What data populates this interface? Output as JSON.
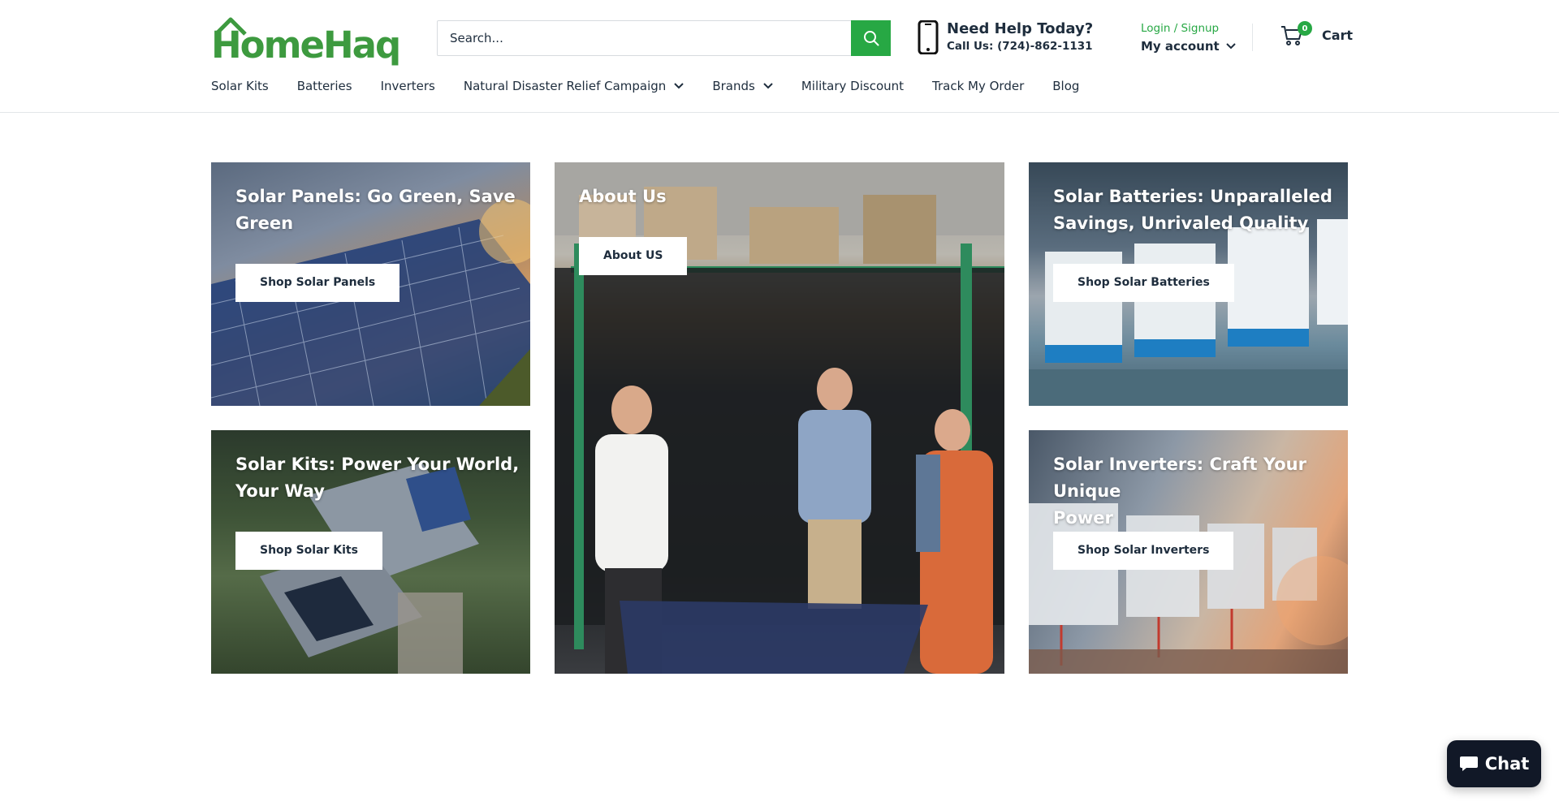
{
  "header": {
    "logo_text": "HomeHaq",
    "search": {
      "placeholder": "Search..."
    },
    "help": {
      "title": "Need Help Today?",
      "phone": "Call Us: (724)-862-1131"
    },
    "account": {
      "login_label": "Login / Signup",
      "account_label": "My account"
    },
    "cart": {
      "count": "0",
      "label": "Cart"
    }
  },
  "nav": {
    "items": [
      {
        "label": "Solar Kits"
      },
      {
        "label": "Batteries"
      },
      {
        "label": "Inverters"
      },
      {
        "label": "Natural Disaster Relief Campaign"
      },
      {
        "label": "Brands"
      },
      {
        "label": "Military Discount"
      },
      {
        "label": "Track My Order"
      },
      {
        "label": "Blog"
      }
    ]
  },
  "tiles": {
    "panels": {
      "title_line1": "Solar Panels: Go Green, Save",
      "title_line2": "Green",
      "button": "Shop Solar Panels"
    },
    "kits": {
      "title_line1": "Solar Kits: Power Your World,",
      "title_line2": "Your Way",
      "button": "Shop Solar Kits"
    },
    "about": {
      "title": "About Us",
      "button": "About US"
    },
    "batteries": {
      "title_line1": "Solar Batteries: Unparalleled",
      "title_line2": "Savings, Unrivaled Quality",
      "button": "Shop Solar Batteries"
    },
    "inverters": {
      "title_line1": "Solar Inverters: Craft Your Unique",
      "title_line2": "Power",
      "button": "Shop Solar Inverters"
    }
  },
  "chat": {
    "label": "Chat"
  },
  "colors": {
    "brand_green": "#27a844",
    "logo_green": "#3d9a3f",
    "text_dark": "#1e2d3d",
    "chat_bg": "#111827"
  }
}
